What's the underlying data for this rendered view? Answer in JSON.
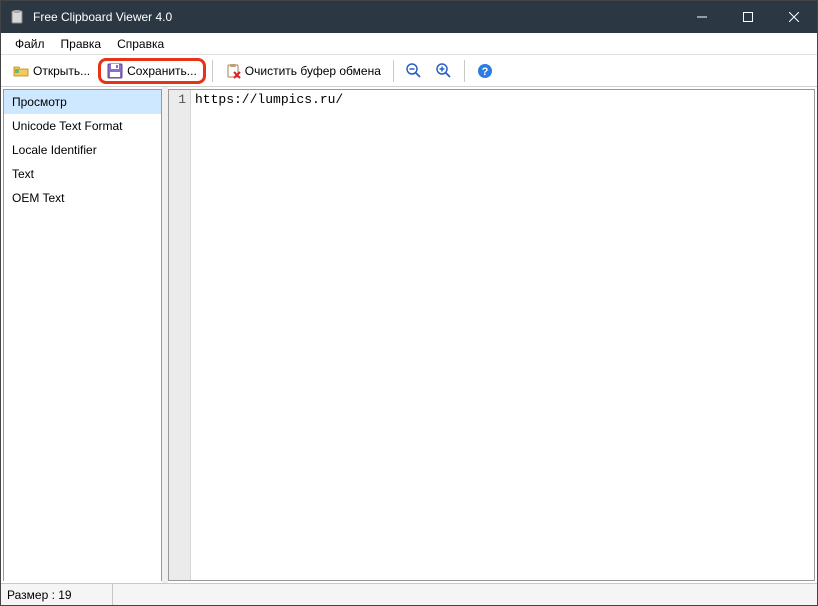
{
  "window": {
    "title": "Free Clipboard Viewer 4.0"
  },
  "menu": {
    "file": "Файл",
    "edit": "Правка",
    "help": "Справка"
  },
  "toolbar": {
    "open": "Открыть...",
    "save": "Сохранить...",
    "clear": "Очистить буфер обмена"
  },
  "sidebar": {
    "items": [
      {
        "label": "Просмотр",
        "selected": true
      },
      {
        "label": "Unicode Text Format",
        "selected": false
      },
      {
        "label": "Locale Identifier",
        "selected": false
      },
      {
        "label": "Text",
        "selected": false
      },
      {
        "label": "OEM Text",
        "selected": false
      }
    ]
  },
  "editor": {
    "line_number": "1",
    "content": "https://lumpics.ru/"
  },
  "status": {
    "size": "Размер : 19"
  }
}
